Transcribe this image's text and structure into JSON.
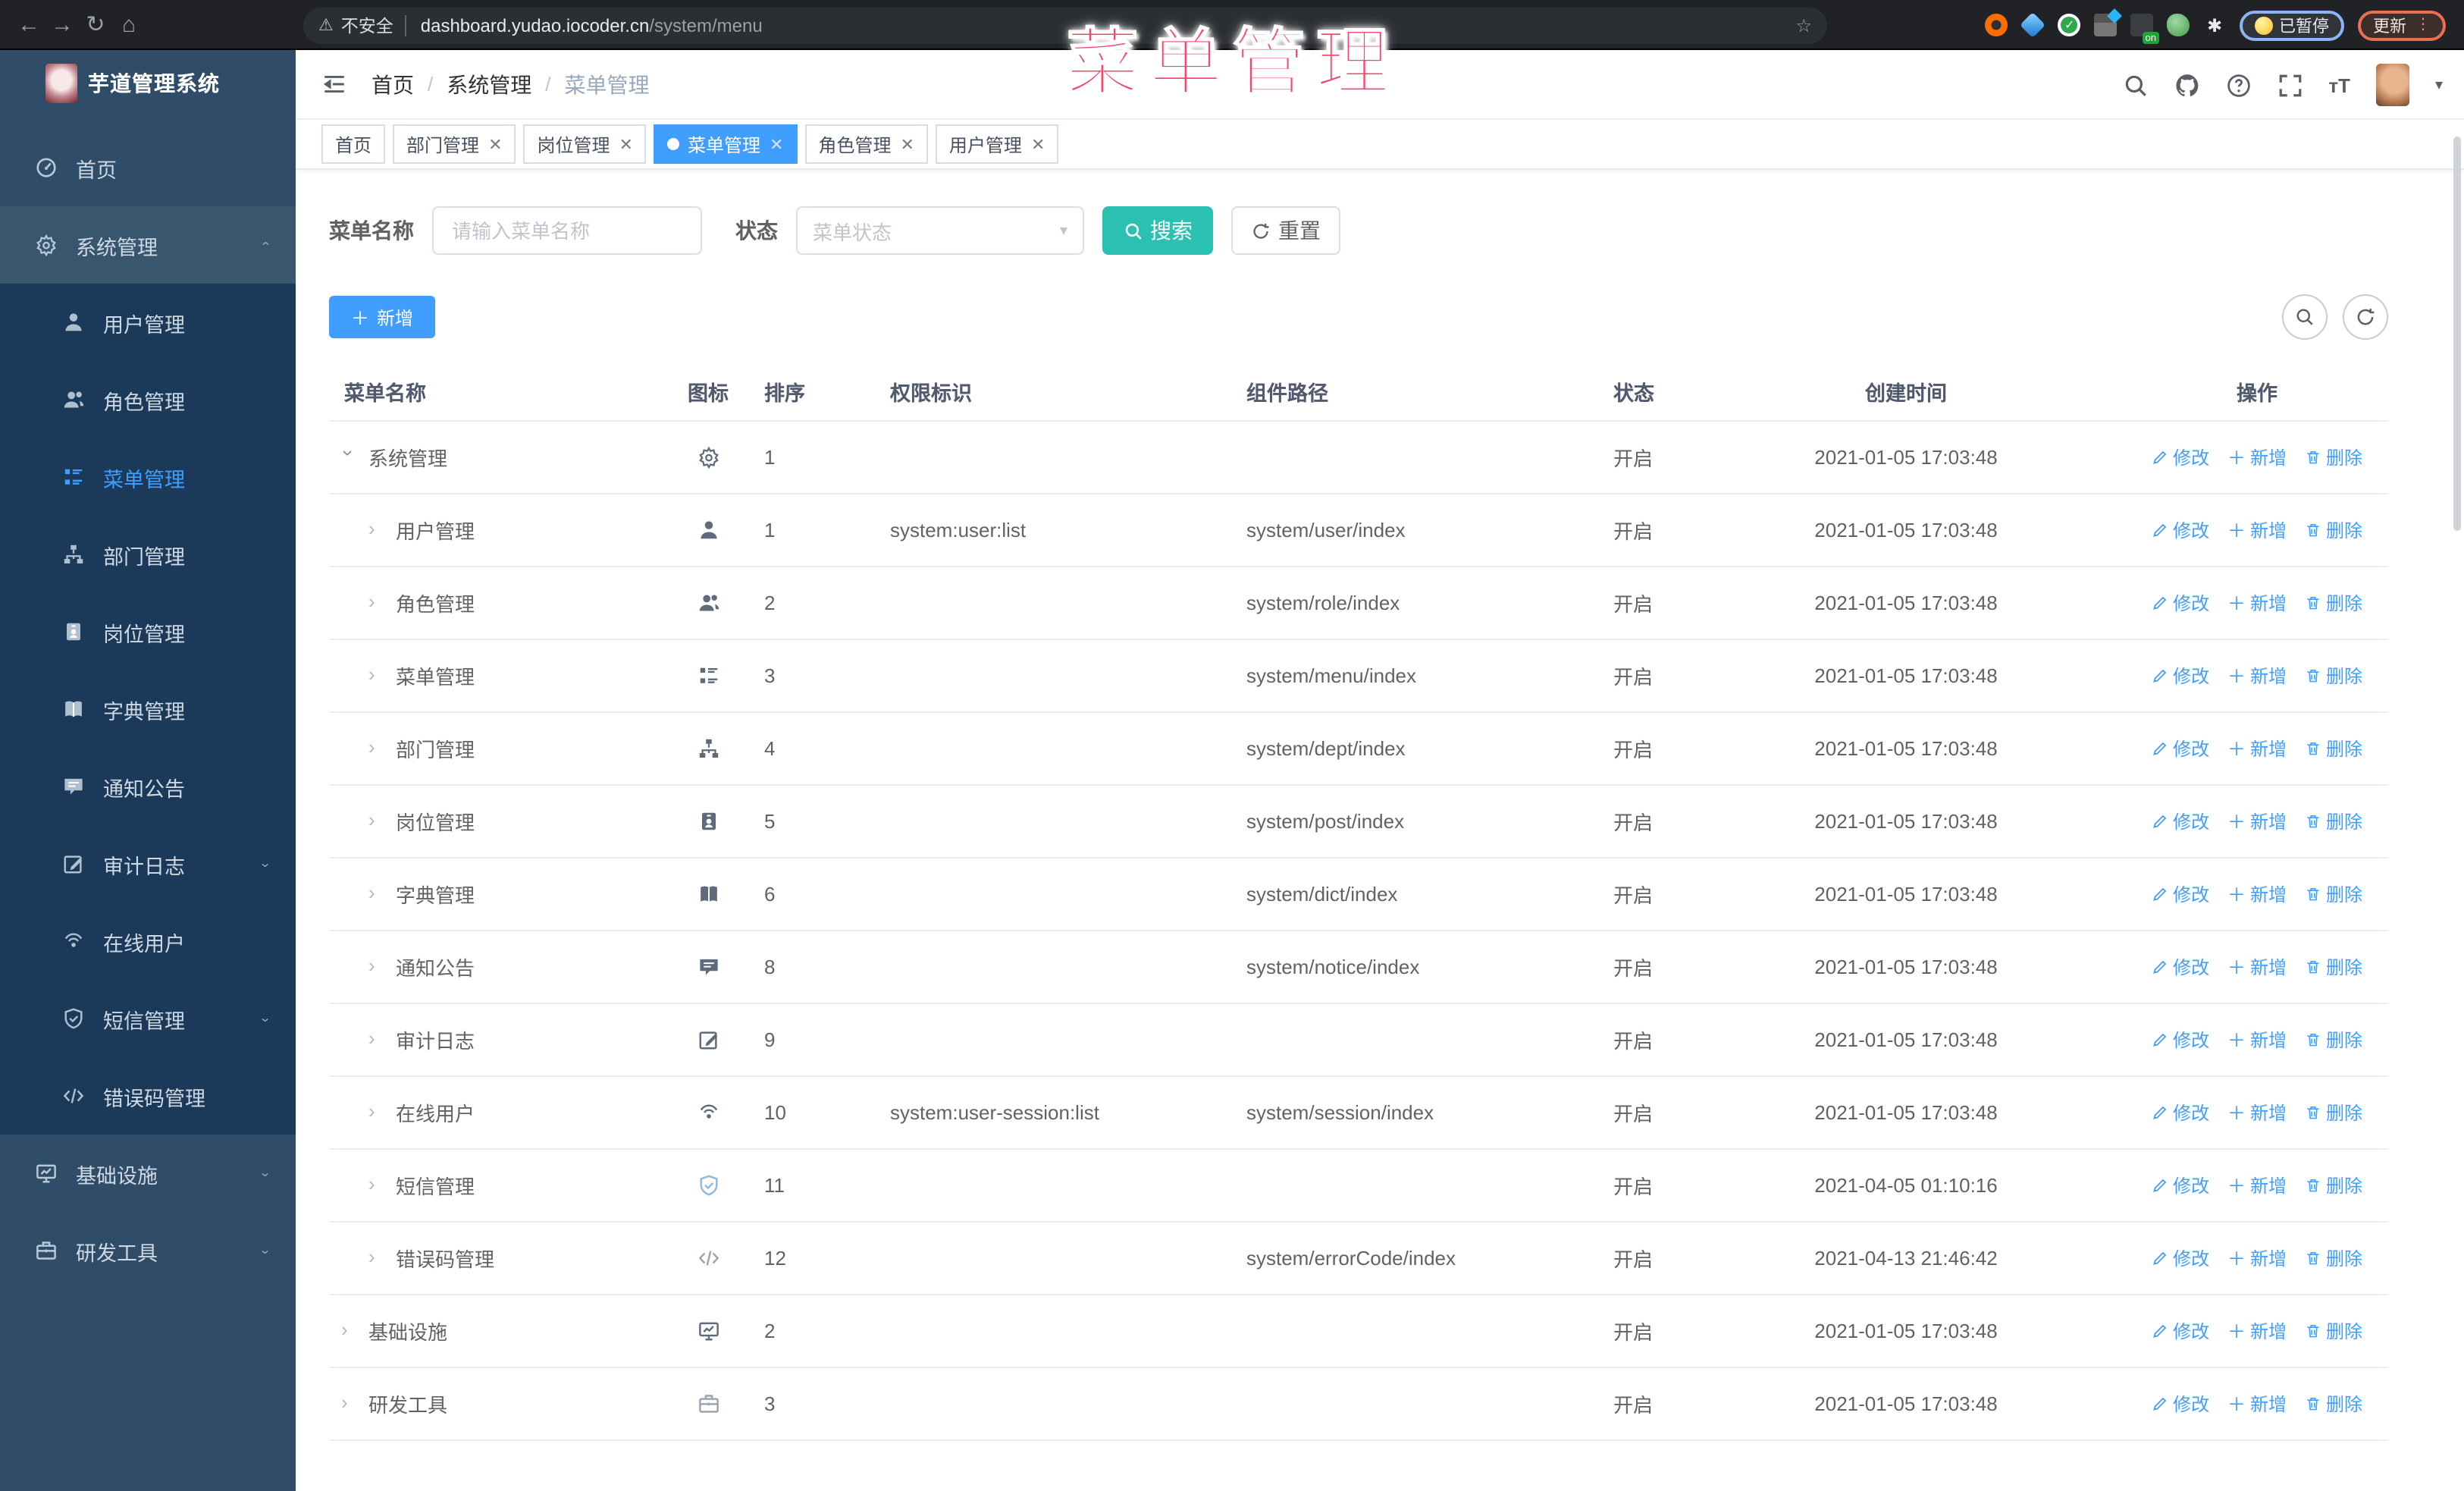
{
  "browser": {
    "secure_label": "不安全",
    "url_host": "dashboard.yudao.iocoder.cn",
    "url_path": "/system/menu",
    "paused_badge": "已暂停",
    "update_badge": "更新"
  },
  "overlay_title": "菜单管理",
  "sidebar": {
    "logo_title": "芋道管理系统",
    "items": [
      {
        "label": "首页",
        "icon": "dashboard-icon",
        "level": 1
      },
      {
        "label": "系统管理",
        "icon": "gear-icon",
        "level": 1,
        "chevron": "up",
        "active_parent": true
      },
      {
        "label": "用户管理",
        "icon": "user-icon",
        "level": 2
      },
      {
        "label": "角色管理",
        "icon": "users-icon",
        "level": 2
      },
      {
        "label": "菜单管理",
        "icon": "menu-list-icon",
        "level": 2,
        "active": true
      },
      {
        "label": "部门管理",
        "icon": "org-tree-icon",
        "level": 2
      },
      {
        "label": "岗位管理",
        "icon": "id-badge-icon",
        "level": 2
      },
      {
        "label": "字典管理",
        "icon": "book-icon",
        "level": 2
      },
      {
        "label": "通知公告",
        "icon": "message-icon",
        "level": 2
      },
      {
        "label": "审计日志",
        "icon": "log-icon",
        "level": 2,
        "chevron": "down"
      },
      {
        "label": "在线用户",
        "icon": "headset-icon",
        "level": 2
      },
      {
        "label": "短信管理",
        "icon": "shield-icon",
        "level": 2,
        "chevron": "down"
      },
      {
        "label": "错误码管理",
        "icon": "code-icon",
        "level": 2
      },
      {
        "label": "基础设施",
        "icon": "monitor-icon",
        "level": 1,
        "chevron": "down"
      },
      {
        "label": "研发工具",
        "icon": "suitcase-icon",
        "level": 1,
        "chevron": "down"
      }
    ]
  },
  "header": {
    "breadcrumb": [
      "首页",
      "系统管理",
      "菜单管理"
    ]
  },
  "tabs": [
    {
      "label": "首页",
      "closable": false
    },
    {
      "label": "部门管理",
      "closable": true
    },
    {
      "label": "岗位管理",
      "closable": true
    },
    {
      "label": "菜单管理",
      "closable": true,
      "active": true
    },
    {
      "label": "角色管理",
      "closable": true
    },
    {
      "label": "用户管理",
      "closable": true
    }
  ],
  "search": {
    "name_label": "菜单名称",
    "name_placeholder": "请输入菜单名称",
    "status_label": "状态",
    "status_placeholder": "菜单状态",
    "search_button": "搜索",
    "reset_button": "重置"
  },
  "toolbar": {
    "add_button": "新增"
  },
  "table": {
    "columns": [
      "菜单名称",
      "图标",
      "排序",
      "权限标识",
      "组件路径",
      "状态",
      "创建时间",
      "操作"
    ],
    "op_labels": {
      "edit": "修改",
      "add": "新增",
      "delete": "删除"
    },
    "rows": [
      {
        "name": "系统管理",
        "level": 1,
        "expanded": true,
        "icon": "gear-icon",
        "sort": "1",
        "perm": "",
        "path": "",
        "status": "开启",
        "time": "2021-01-05 17:03:48"
      },
      {
        "name": "用户管理",
        "level": 2,
        "icon": "user-icon",
        "sort": "1",
        "perm": "system:user:list",
        "path": "system/user/index",
        "status": "开启",
        "time": "2021-01-05 17:03:48"
      },
      {
        "name": "角色管理",
        "level": 2,
        "icon": "users-icon",
        "sort": "2",
        "perm": "",
        "path": "system/role/index",
        "status": "开启",
        "time": "2021-01-05 17:03:48"
      },
      {
        "name": "菜单管理",
        "level": 2,
        "icon": "menu-list-icon",
        "sort": "3",
        "perm": "",
        "path": "system/menu/index",
        "status": "开启",
        "time": "2021-01-05 17:03:48"
      },
      {
        "name": "部门管理",
        "level": 2,
        "icon": "org-tree-icon",
        "sort": "4",
        "perm": "",
        "path": "system/dept/index",
        "status": "开启",
        "time": "2021-01-05 17:03:48"
      },
      {
        "name": "岗位管理",
        "level": 2,
        "icon": "id-badge-icon",
        "sort": "5",
        "perm": "",
        "path": "system/post/index",
        "status": "开启",
        "time": "2021-01-05 17:03:48"
      },
      {
        "name": "字典管理",
        "level": 2,
        "icon": "book-icon",
        "sort": "6",
        "perm": "",
        "path": "system/dict/index",
        "status": "开启",
        "time": "2021-01-05 17:03:48"
      },
      {
        "name": "通知公告",
        "level": 2,
        "icon": "message-icon",
        "sort": "8",
        "perm": "",
        "path": "system/notice/index",
        "status": "开启",
        "time": "2021-01-05 17:03:48"
      },
      {
        "name": "审计日志",
        "level": 2,
        "icon": "log-icon",
        "sort": "9",
        "perm": "",
        "path": "",
        "status": "开启",
        "time": "2021-01-05 17:03:48"
      },
      {
        "name": "在线用户",
        "level": 2,
        "icon": "headset-icon",
        "sort": "10",
        "perm": "system:user-session:list",
        "path": "system/session/index",
        "status": "开启",
        "time": "2021-01-05 17:03:48"
      },
      {
        "name": "短信管理",
        "level": 2,
        "icon": "shield-icon",
        "icon_tone": "light",
        "sort": "11",
        "perm": "",
        "path": "",
        "status": "开启",
        "time": "2021-04-05 01:10:16"
      },
      {
        "name": "错误码管理",
        "level": 2,
        "icon": "code-icon",
        "icon_tone": "dim",
        "sort": "12",
        "perm": "",
        "path": "system/errorCode/index",
        "status": "开启",
        "time": "2021-04-13 21:46:42"
      },
      {
        "name": "基础设施",
        "level": 1,
        "icon": "monitor-icon",
        "sort": "2",
        "perm": "",
        "path": "",
        "status": "开启",
        "time": "2021-01-05 17:03:48"
      },
      {
        "name": "研发工具",
        "level": 1,
        "icon": "suitcase-icon",
        "icon_tone": "dim",
        "sort": "3",
        "perm": "",
        "path": "",
        "status": "开启",
        "time": "2021-01-05 17:03:48"
      }
    ]
  },
  "colors": {
    "accent": "#409eff",
    "search_button": "#2ac1b3",
    "overlay_title": "#f8456b",
    "sidebar_bg": "#2f4d68",
    "submenu_bg": "#1b3a59"
  }
}
